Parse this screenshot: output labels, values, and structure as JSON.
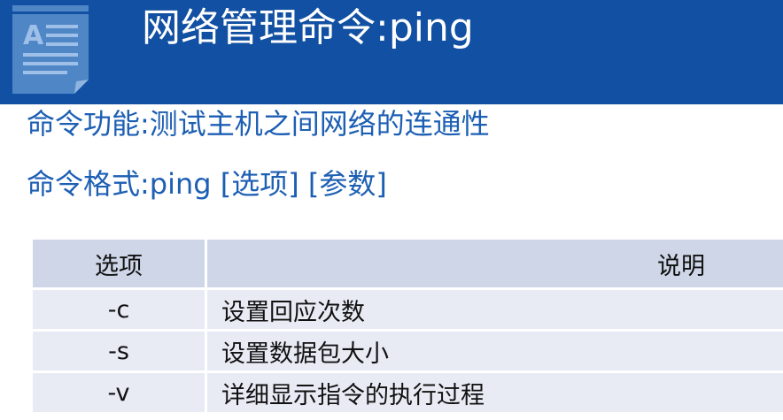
{
  "header": {
    "title": "网络管理命令:ping",
    "band_color": "#1150a2",
    "icon": "document-icon"
  },
  "body": {
    "function_line": "命令功能:测试主机之间网络的连通性",
    "format_line": "命令格式:ping [选项] [参数]",
    "text_color": "#1d5fb3"
  },
  "table": {
    "columns": [
      "选项",
      "说明"
    ],
    "rows": [
      {
        "option": "-c",
        "description": "设置回应次数"
      },
      {
        "option": "-s",
        "description": "设置数据包大小"
      },
      {
        "option": "-v",
        "description": "详细显示指令的执行过程"
      }
    ],
    "header_bg": "#cfd6e8",
    "row_bg": "#e8ebf4"
  }
}
